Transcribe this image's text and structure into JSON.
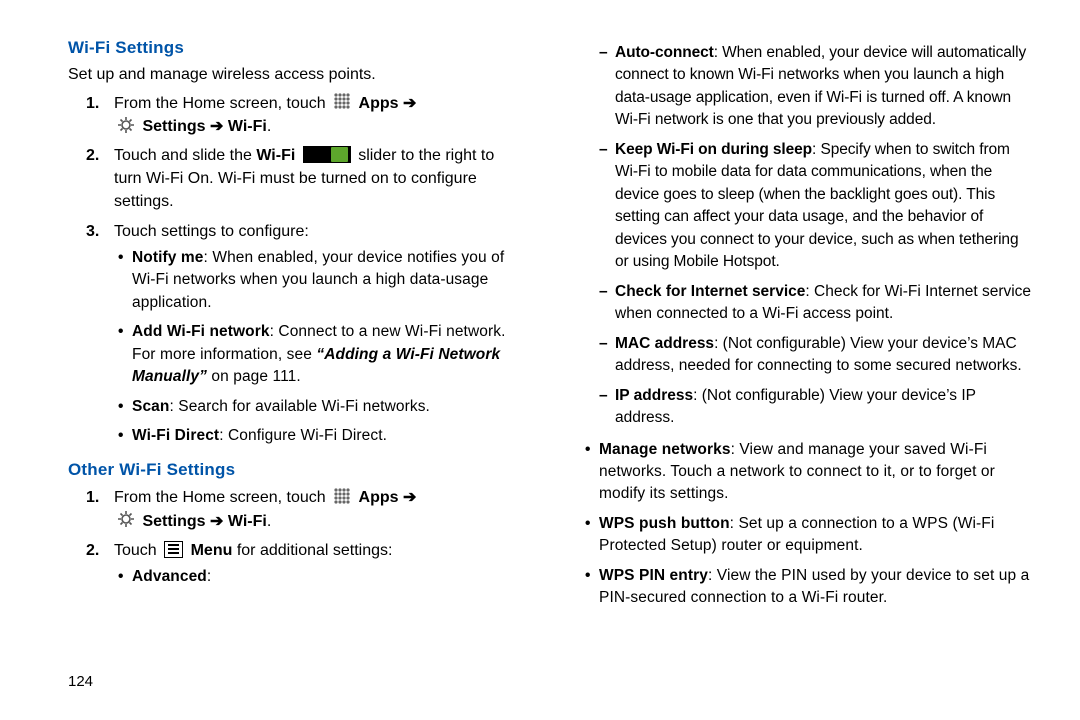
{
  "page_number": "124",
  "left": {
    "h1": "Wi-Fi Settings",
    "intro": "Set up and manage wireless access points.",
    "step1_a": "From the Home screen, touch ",
    "apps": "Apps",
    "settings_wifi": "Settings",
    "wifi_label": "Wi-Fi",
    "step2_a": "Touch and slide the ",
    "step2_b": "Wi-Fi",
    "step2_c": " slider to the right to turn Wi-Fi On. Wi-Fi must be turned on to configure settings.",
    "step3": "Touch settings to configure:",
    "notify_t": "Notify me",
    "notify_b": ": When enabled, your device notifies you of Wi-Fi networks when you launch a high data-usage application.",
    "add_t": "Add Wi-Fi network",
    "add_b": ": Connect to a new Wi-Fi network. For more information, see ",
    "add_ref": "“Adding a Wi-Fi Network Manually”",
    "add_ref_pg": " on page 111.",
    "scan_t": "Scan",
    "scan_b": ": Search for available Wi-Fi networks.",
    "wfd_t": "Wi-Fi Direct",
    "wfd_b": ": Configure Wi-Fi Direct.",
    "h2": "Other Wi-Fi Settings",
    "o_step1": "From the Home screen, touch ",
    "o_step2_a": "Touch ",
    "o_step2_menu": "Menu",
    "o_step2_b": " for additional settings:",
    "adv_t": "Advanced",
    "adv_b": ":",
    "switch_label": "ON"
  },
  "right": {
    "auto_t": "Auto-connect",
    "auto_b": ": When enabled, your device will automatically connect to known Wi-Fi networks when you launch a high data-usage application, even if Wi-Fi is turned off. A known Wi-Fi network is one that you previously added.",
    "keep_t": "Keep Wi-Fi on during sleep",
    "keep_b": ": Specify when to switch from Wi-Fi to mobile data for data communications, when the device goes to sleep (when the backlight goes out). This setting can affect your data usage, and the behavior of devices you connect to your device, such as when tethering or using Mobile Hotspot.",
    "check_t": "Check for Internet service",
    "check_b": ": Check for Wi-Fi Internet service when connected to a Wi-Fi access point.",
    "mac_t": "MAC address",
    "mac_b": ": (Not configurable) View your device’s MAC address, needed for connecting to some secured networks.",
    "ip_t": "IP address",
    "ip_b": ": (Not configurable) View your device’s IP address.",
    "mng_t": "Manage networks",
    "mng_b": ": View and manage your saved Wi-Fi networks. Touch a network to connect to it, or to forget or modify its settings.",
    "wps_t": "WPS push button",
    "wps_b": ": Set up a connection to a WPS (Wi-Fi Protected Setup) router or equipment.",
    "pin_t": "WPS PIN entry",
    "pin_b": ": View the PIN used by your device to set up a PIN-secured connection to a Wi-Fi router."
  }
}
